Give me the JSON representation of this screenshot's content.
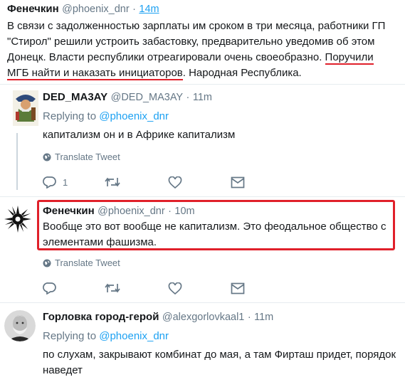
{
  "tweet1": {
    "name": "Фенечкин",
    "handle": "@phoenix_dnr",
    "separator": "·",
    "time": "14m",
    "line1": "В связи с задолженностью зарплаты им сроком в три месяца, работники ГП",
    "line2": "\"Стирол\" решили устроить забастовку, предварительно уведомив об этом",
    "line3_a": "Донецк. Власти республики отреагировали очень своеобразно. ",
    "line3_b": "Поручили",
    "line4_a": "МГБ найти и наказать инициаторов",
    "line4_b": ". Народная Республика."
  },
  "tweet2": {
    "name": "DED_MA3AY",
    "handle": "@DED_MA3AY",
    "separator": "·",
    "time": "11m",
    "replying_prefix": "Replying to ",
    "replying_handle": "@phoenix_dnr",
    "text": "капитализм он и в Африке капитализм",
    "translate": "Translate Tweet",
    "reply_count": "1"
  },
  "tweet3": {
    "name": "Фенечкин",
    "handle": "@phoenix_dnr",
    "separator": "·",
    "time": "10m",
    "line1": "Вообще это вот вообще не капитализм. Это феодальное общество с",
    "line2": "элементами фашизма.",
    "translate": "Translate Tweet",
    "highlight_color": "#e0202a"
  },
  "tweet4": {
    "name": "Горловка город-герой",
    "handle": "@alexgorlovkaal1",
    "separator": "·",
    "time": "11m",
    "replying_prefix": "Replying to ",
    "replying_handle": "@phoenix_dnr",
    "line1": "по слухам, закрывают комбинат до мая, а там Фирташ придет, порядок",
    "line2": "наведет"
  },
  "colors": {
    "accent": "#1da1f2",
    "muted": "#657786",
    "annotation_red": "#e0202a"
  },
  "icons": [
    "reply-icon",
    "retweet-icon",
    "like-icon",
    "dm-icon",
    "globe-icon"
  ]
}
